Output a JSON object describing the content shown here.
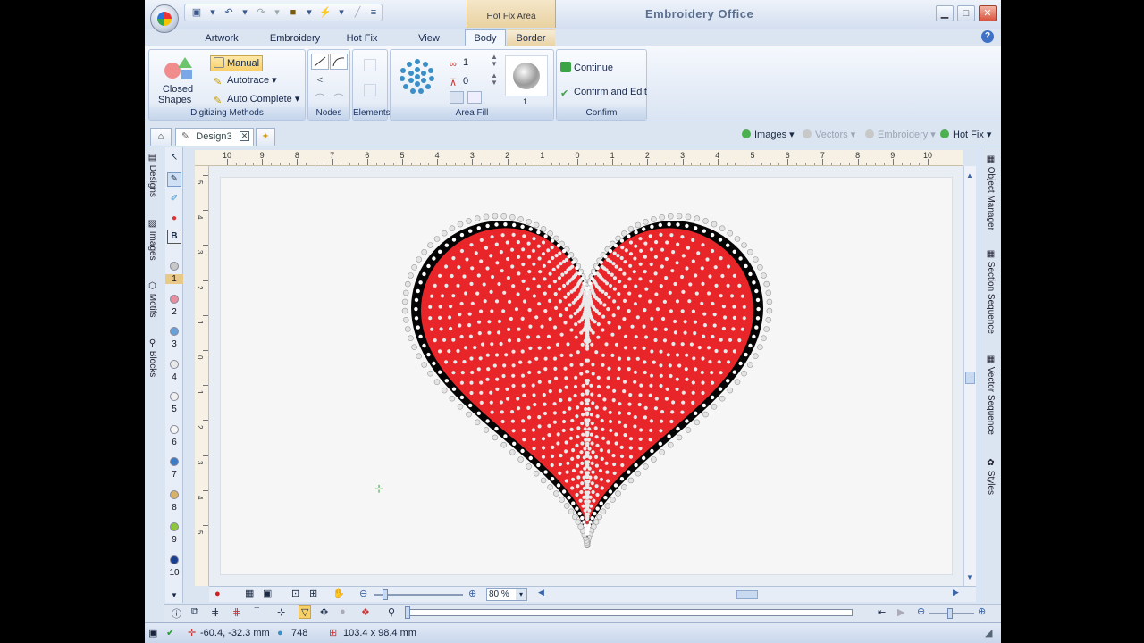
{
  "window": {
    "title": "Embroidery Office",
    "context_tab": "Hot Fix Area",
    "minimize": "▁",
    "maximize": "□",
    "close": "✕"
  },
  "ribbon_tabs": [
    "Artwork",
    "Embroidery",
    "Hot Fix",
    "View",
    "Body",
    "Border"
  ],
  "selected_tab": "Body",
  "help": "?",
  "groups": {
    "digitizing": {
      "label": "Digitizing Methods",
      "closed_shapes_line1": "Closed",
      "closed_shapes_line2": "Shapes",
      "manual": "Manual",
      "autotrace": "Autotrace",
      "auto_complete": "Auto Complete"
    },
    "nodes": {
      "label": "Nodes"
    },
    "elements": {
      "label": "Elements"
    },
    "area_fill": {
      "label": "Area Fill",
      "value1": "1",
      "value2": "0",
      "preview_number": "1"
    },
    "confirm": {
      "label": "Confirm",
      "continue": "Continue",
      "confirm_and_edit": "Confirm and Edit"
    }
  },
  "doc_tab": {
    "name": "Design3"
  },
  "filters": [
    {
      "label": "Images",
      "color": "#4caf50",
      "active": true
    },
    {
      "label": "Vectors",
      "color": "#c8c8c8",
      "active": false
    },
    {
      "label": "Embroidery",
      "color": "#c8c8c8",
      "active": false
    },
    {
      "label": "Hot Fix",
      "color": "#4caf50",
      "active": true
    }
  ],
  "left_panels": [
    "Designs",
    "Images",
    "Motifs",
    "Blocks"
  ],
  "right_panels": [
    "Object Manager",
    "Section Sequence",
    "Vector Sequence",
    "Styles"
  ],
  "ruler": {
    "unit": "cm",
    "h_labels": [
      "10",
      "9",
      "8",
      "7",
      "6",
      "5",
      "4",
      "3",
      "2",
      "1",
      "0",
      "1",
      "2",
      "3",
      "4",
      "5",
      "6",
      "7",
      "8",
      "9",
      "10"
    ],
    "v_labels": [
      "5",
      "4",
      "3",
      "2",
      "1",
      "0",
      "1",
      "2",
      "3",
      "4",
      "5"
    ]
  },
  "color_slots": [
    {
      "num": "1",
      "color": "#c8c8c8"
    },
    {
      "num": "2",
      "color": "#e58fa0"
    },
    {
      "num": "3",
      "color": "#6aa0d8"
    },
    {
      "num": "4",
      "color": "#e8e8e8"
    },
    {
      "num": "5",
      "color": "#f0f0f0"
    },
    {
      "num": "6",
      "color": "#f5f5f5"
    },
    {
      "num": "7",
      "color": "#3d7bc4"
    },
    {
      "num": "8",
      "color": "#d6b26a"
    },
    {
      "num": "9",
      "color": "#8dc63f"
    },
    {
      "num": "10",
      "color": "#1b3f8f"
    }
  ],
  "zoom": {
    "value": "80 %"
  },
  "status": {
    "coords": "-60.4, -32.3 mm",
    "count": "748",
    "size": "103.4 x 98.4 mm"
  },
  "colors": {
    "heart_fill": "#e8262a",
    "heart_border": "#050505",
    "stone": "#e4e4e4",
    "accent": "#3f72c6"
  }
}
